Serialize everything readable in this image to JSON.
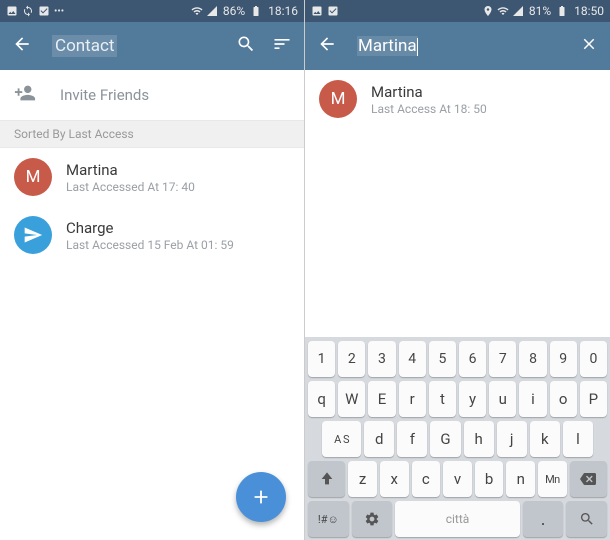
{
  "left": {
    "status": {
      "battery": "86%",
      "time": "18:16"
    },
    "appbar": {
      "title": "Contact"
    },
    "invite_label": "Invite Friends",
    "section_header": "Sorted By Last Access",
    "contacts": [
      {
        "initial": "M",
        "name": "Martina",
        "status": "Last Accessed At 17: 40",
        "avatar_color": "red"
      },
      {
        "initial": "",
        "name": "Charge",
        "status": "Last Accessed 15 Feb At 01: 59",
        "avatar_color": "blue"
      }
    ]
  },
  "right": {
    "status": {
      "battery": "81%",
      "time": "18:50"
    },
    "appbar": {
      "search_value": "Martina"
    },
    "results": [
      {
        "initial": "M",
        "name": "Martina",
        "status": "Last Access At 18: 50",
        "avatar_color": "red"
      }
    ],
    "keyboard": {
      "row1": [
        "1",
        "2",
        "3",
        "4",
        "5",
        "6",
        "7",
        "8",
        "9",
        "0"
      ],
      "row2": [
        {
          "m": "q"
        },
        {
          "m": "W",
          "s": ""
        },
        {
          "m": "E",
          "s": ""
        },
        {
          "m": "r"
        },
        {
          "m": "t"
        },
        {
          "m": "y"
        },
        {
          "m": "u"
        },
        {
          "m": "i"
        },
        {
          "m": "o"
        },
        {
          "m": "P",
          "s": ""
        }
      ],
      "row3": [
        {
          "m": "A S",
          "combo": true
        },
        {
          "m": "d"
        },
        {
          "m": "f"
        },
        {
          "m": "G",
          "s": ""
        },
        {
          "m": "h"
        },
        {
          "m": "j"
        },
        {
          "m": "k"
        },
        {
          "m": "l"
        }
      ],
      "row4": [
        "z",
        "x",
        "c",
        "v",
        "b",
        "n"
      ],
      "row4_mn": "Mn",
      "row5": {
        "sym": "!#☺",
        "space": "città"
      }
    }
  }
}
